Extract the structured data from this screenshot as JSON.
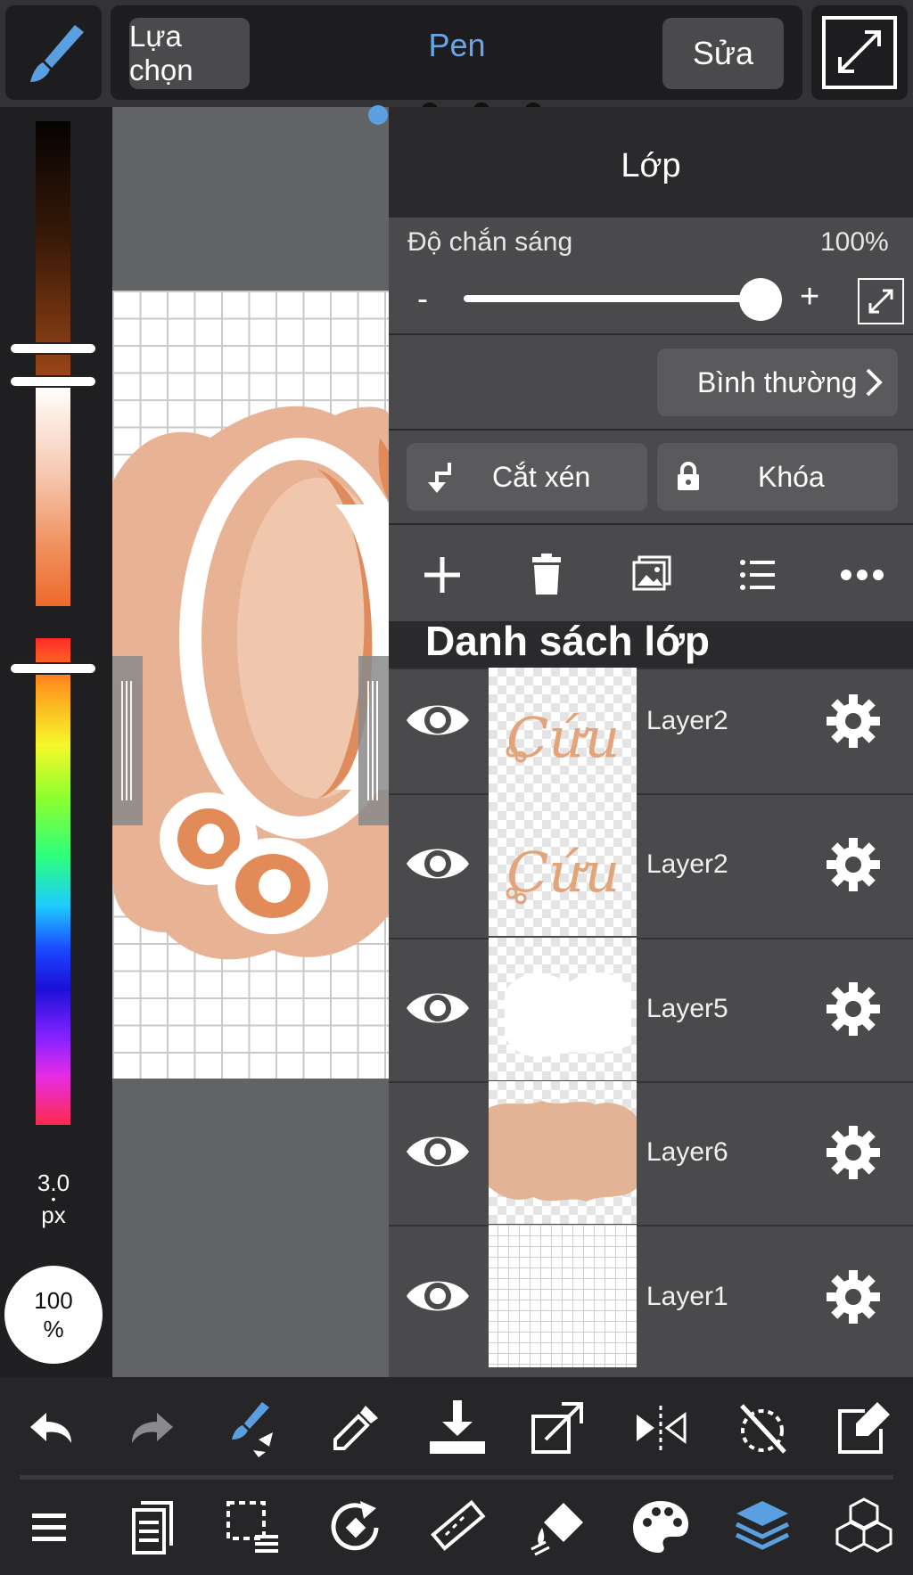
{
  "top_bar": {
    "select_label": "Lựa chọn",
    "tool_name": "Pen",
    "edit_label": "Sửa"
  },
  "left_bar": {
    "brush_size_value": "3.0",
    "brush_size_unit": "px",
    "opacity_value": "100",
    "opacity_unit": "%"
  },
  "layer_panel": {
    "title": "Lớp",
    "opacity_label": "Độ chắn sáng",
    "opacity_value": "100%",
    "opacity_level": 1.0,
    "opacity_minus": "-",
    "opacity_plus": "+",
    "blend_mode": "Bình thường",
    "clip_label": "Cắt xén",
    "lock_label": "Khóa",
    "list_title": "Danh sách lớp",
    "layers": [
      {
        "name": "Layer2",
        "visible": true,
        "thumb_text": "Cứu"
      },
      {
        "name": "Layer2",
        "visible": true,
        "thumb_text": "Cứu"
      },
      {
        "name": "Layer5",
        "visible": true,
        "thumb_text": ""
      },
      {
        "name": "Layer6",
        "visible": true,
        "thumb_text": ""
      },
      {
        "name": "Layer1",
        "visible": true,
        "thumb_text": ""
      }
    ]
  },
  "icons": {
    "top": [
      "brush-icon",
      "fullscreen-icon"
    ],
    "panel_tools": [
      "add-layer-icon",
      "trash-icon",
      "image-icon",
      "list-icon",
      "more-icon"
    ],
    "toolbar1": [
      "undo-icon",
      "redo-icon",
      "brush-transform-icon",
      "eyedropper-icon",
      "download-icon",
      "export-icon",
      "flip-horizontal-icon",
      "rotate-off-icon",
      "edit-frame-icon"
    ],
    "toolbar2": [
      "menu-icon",
      "pages-icon",
      "selection-list-icon",
      "rotate-icon",
      "ruler-icon",
      "fill-icon",
      "palette-icon",
      "layers-icon",
      "materials-icon"
    ]
  },
  "colors": {
    "accent_blue": "#6aa6e6",
    "panel_bg": "#4a4a4c",
    "art_peach": "#e8b295",
    "art_orange": "#e38a59"
  }
}
